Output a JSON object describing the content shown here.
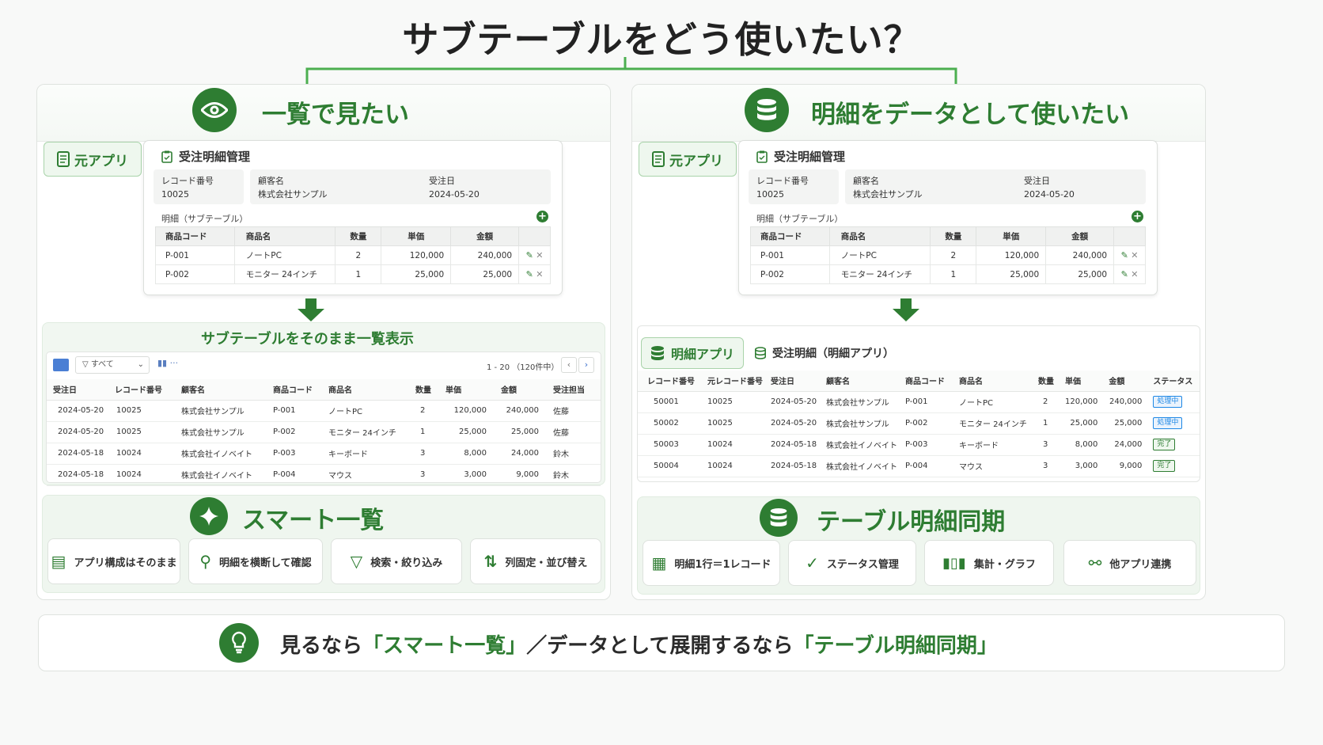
{
  "title": "サブテーブルをどう使いたい？",
  "left": {
    "title": "一覧で見たい",
    "source_badge": "元アプリ",
    "card": {
      "title": "受注明細管理",
      "fields": [
        {
          "label": "レコード番号",
          "value": "10025"
        },
        {
          "label": "顧客名",
          "value": "株式会社サンプル"
        },
        {
          "label": "受注日",
          "value": "2024-05-20"
        }
      ],
      "subtable_label": "明細（サブテーブル）",
      "columns": [
        "商品コード",
        "商品名",
        "数量",
        "単価",
        "金額"
      ],
      "rows": [
        [
          "P-001",
          "ノートPC",
          "2",
          "120,000",
          "240,000"
        ],
        [
          "P-002",
          "モニター 24インチ",
          "1",
          "25,000",
          "25,000"
        ]
      ]
    },
    "list_title": "サブテーブルをそのまま一覧表示",
    "list_toolbar": {
      "filter": "すべて",
      "paging": "1 - 20 （120件中）"
    },
    "list_columns": [
      "受注日",
      "レコード番号",
      "顧客名",
      "商品コード",
      "商品名",
      "数量",
      "単価",
      "金額",
      "受注担当"
    ],
    "list_rows": [
      [
        "2024-05-20",
        "10025",
        "株式会社サンプル",
        "P-001",
        "ノートPC",
        "2",
        "120,000",
        "240,000",
        "佐藤"
      ],
      [
        "2024-05-20",
        "10025",
        "株式会社サンプル",
        "P-002",
        "モニター 24インチ",
        "1",
        "25,000",
        "25,000",
        "佐藤"
      ],
      [
        "2024-05-18",
        "10024",
        "株式会社イノベイト",
        "P-003",
        "キーボード",
        "3",
        "8,000",
        "24,000",
        "鈴木"
      ],
      [
        "2024-05-18",
        "10024",
        "株式会社イノベイト",
        "P-004",
        "マウス",
        "3",
        "3,000",
        "9,000",
        "鈴木"
      ]
    ],
    "feature_title": "スマート一覧",
    "features": [
      "アプリ構成はそのまま",
      "明細を横断して確認",
      "検索・絞り込み",
      "列固定・並び替え"
    ]
  },
  "right": {
    "title": "明細をデータとして使いたい",
    "source_badge": "元アプリ",
    "card": {
      "title": "受注明細管理",
      "fields": [
        {
          "label": "レコード番号",
          "value": "10025"
        },
        {
          "label": "顧客名",
          "value": "株式会社サンプル"
        },
        {
          "label": "受注日",
          "value": "2024-05-20"
        }
      ],
      "subtable_label": "明細（サブテーブル）",
      "columns": [
        "商品コード",
        "商品名",
        "数量",
        "単価",
        "金額"
      ],
      "rows": [
        [
          "P-001",
          "ノートPC",
          "2",
          "120,000",
          "240,000"
        ],
        [
          "P-002",
          "モニター 24インチ",
          "1",
          "25,000",
          "25,000"
        ]
      ]
    },
    "detail_badge": "明細アプリ",
    "detail_title": "受注明細（明細アプリ）",
    "detail_columns": [
      "レコード番号",
      "元レコード番号",
      "受注日",
      "顧客名",
      "商品コード",
      "商品名",
      "数量",
      "単価",
      "金額",
      "ステータス"
    ],
    "detail_rows": [
      [
        "50001",
        "10025",
        "2024-05-20",
        "株式会社サンプル",
        "P-001",
        "ノートPC",
        "2",
        "120,000",
        "240,000",
        "処理中"
      ],
      [
        "50002",
        "10025",
        "2024-05-20",
        "株式会社サンプル",
        "P-002",
        "モニター 24インチ",
        "1",
        "25,000",
        "25,000",
        "処理中"
      ],
      [
        "50003",
        "10024",
        "2024-05-18",
        "株式会社イノベイト",
        "P-003",
        "キーボード",
        "3",
        "8,000",
        "24,000",
        "完了"
      ],
      [
        "50004",
        "10024",
        "2024-05-18",
        "株式会社イノベイト",
        "P-004",
        "マウス",
        "3",
        "3,000",
        "9,000",
        "完了"
      ]
    ],
    "feature_title": "テーブル明細同期",
    "features": [
      "明細1行＝1レコード",
      "ステータス管理",
      "集計・グラフ",
      "他アプリ連携"
    ]
  },
  "bottom": {
    "part1": "見るなら",
    "part2": "「スマート一覧」",
    "part3": "／データとして展開するなら",
    "part4": "「テーブル明細同期」"
  },
  "colors": {
    "accent": "#2e7d32",
    "status_processing": "#1e88e5",
    "status_done": "#2e7d32"
  }
}
